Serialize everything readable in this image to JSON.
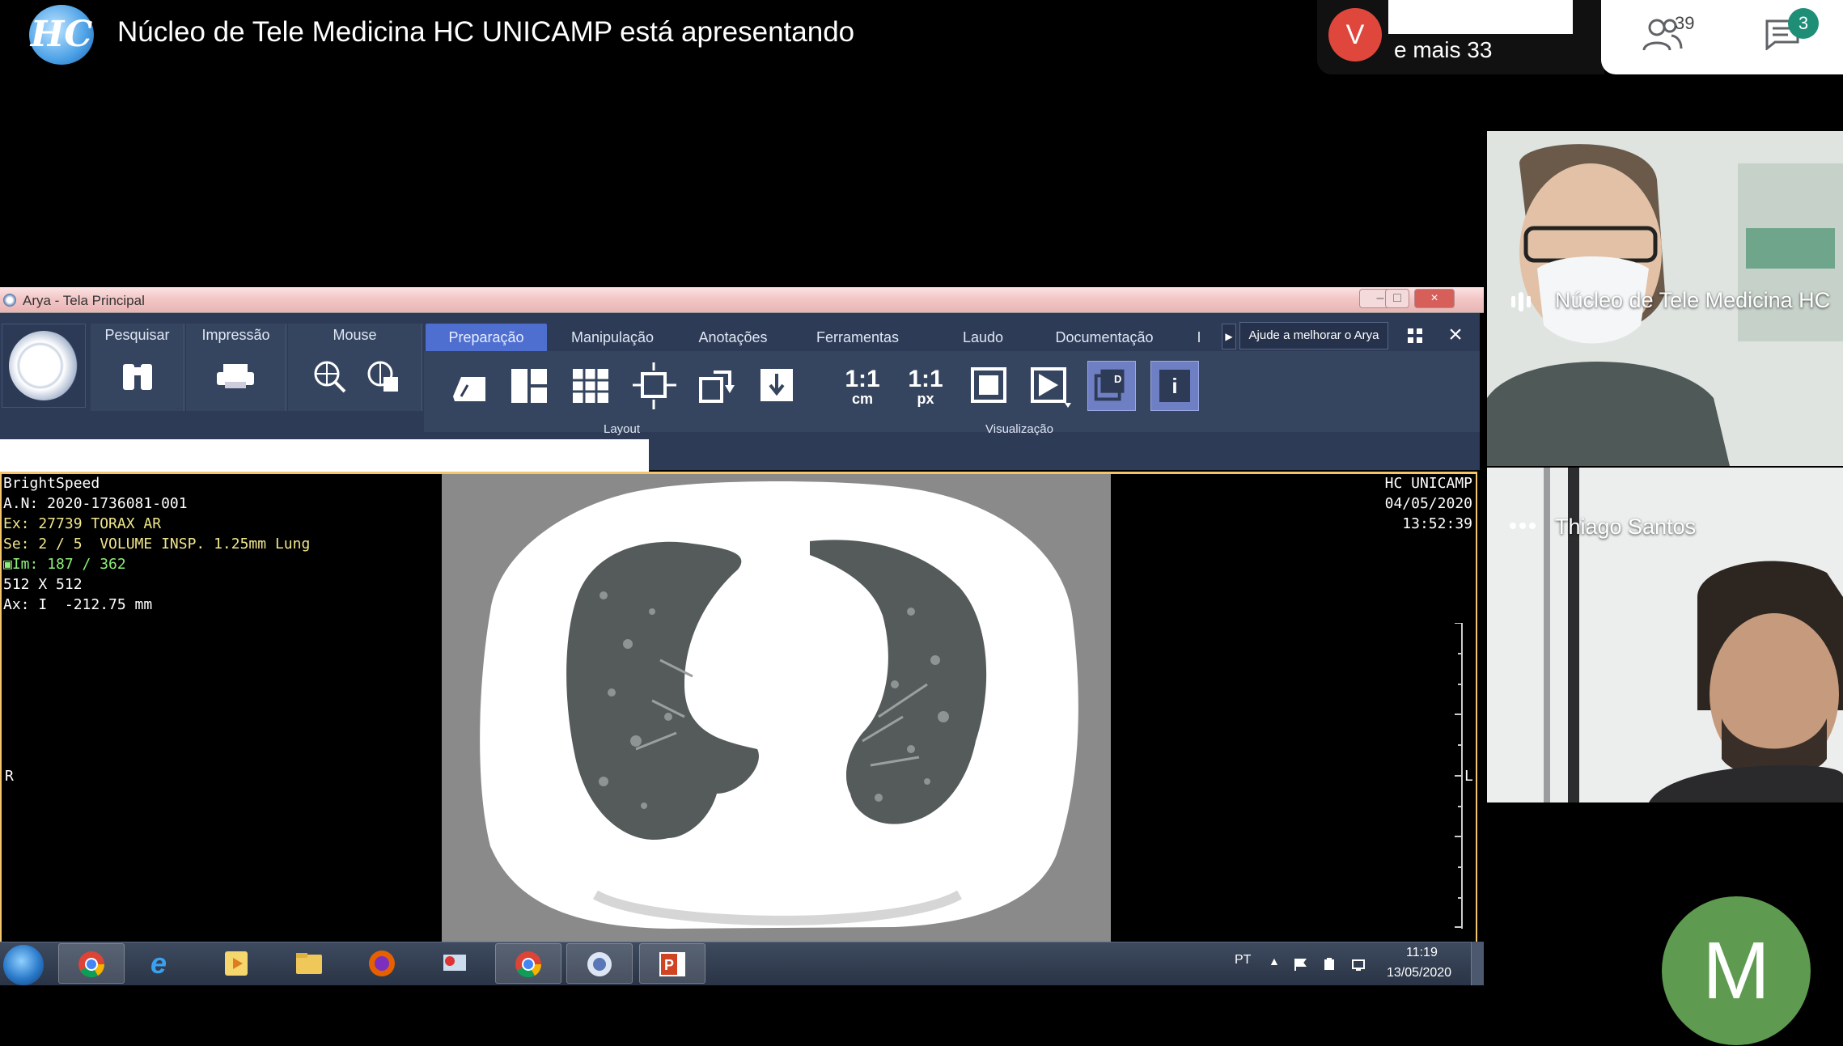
{
  "meet": {
    "presenting_text": "Núcleo de Tele Medicina HC UNICAMP está apresentando",
    "logo_text": "HC",
    "top_avatar_letter": "V",
    "more_participants": "e mais 33",
    "participants_count": "39",
    "chat_badge": "3",
    "accent_red": "#e0473c",
    "chat_badge_color": "#1e8e76"
  },
  "app": {
    "window_title": "Arya - Tela Principal",
    "groups": [
      {
        "label": "Pesquisar"
      },
      {
        "label": "Impressão"
      },
      {
        "label": "Mouse"
      }
    ],
    "tabs": [
      "Preparação",
      "Manipulação",
      "Anotações",
      "Ferramentas",
      "Laudo",
      "Documentação",
      "I"
    ],
    "help_button": "Ajude a melhorar o Arya",
    "close_glyph": "×",
    "section_layout": "Layout",
    "section_visualizacao": "Visualização",
    "tool_1_1_cm_top": "1:1",
    "tool_1_1_cm_bottom": "cm",
    "tool_1_1_px_top": "1:1",
    "tool_1_1_px_bottom": "px",
    "tool_info": "i",
    "tool_d": "D"
  },
  "viewer": {
    "top_left": {
      "line1": "BrightSpeed",
      "line2": "A.N: 2020-1736081-001",
      "line3": "Ex: 27739 TORAX AR",
      "line4": "Se: 2 / 5  VOLUME INSP. 1.25mm Lung",
      "line5": "Im: 187 / 362",
      "line6": "512 X 512",
      "line7": "Ax: I  -212.75 mm"
    },
    "top_right": {
      "institution": "HC UNICAMP",
      "date": "04/05/2020",
      "time": "13:52:39"
    },
    "orientation_left": "R",
    "orientation_right": "L"
  },
  "taskbar": {
    "language": "PT",
    "clock_time": "11:19",
    "clock_date": "13/05/2020"
  },
  "participants": {
    "tile1_name": "Núcleo de Tele Medicina HC",
    "tile2_name": "Thiago Santos",
    "avatar_m_letter": "M",
    "avatar_m_color": "#5e9a4f"
  }
}
